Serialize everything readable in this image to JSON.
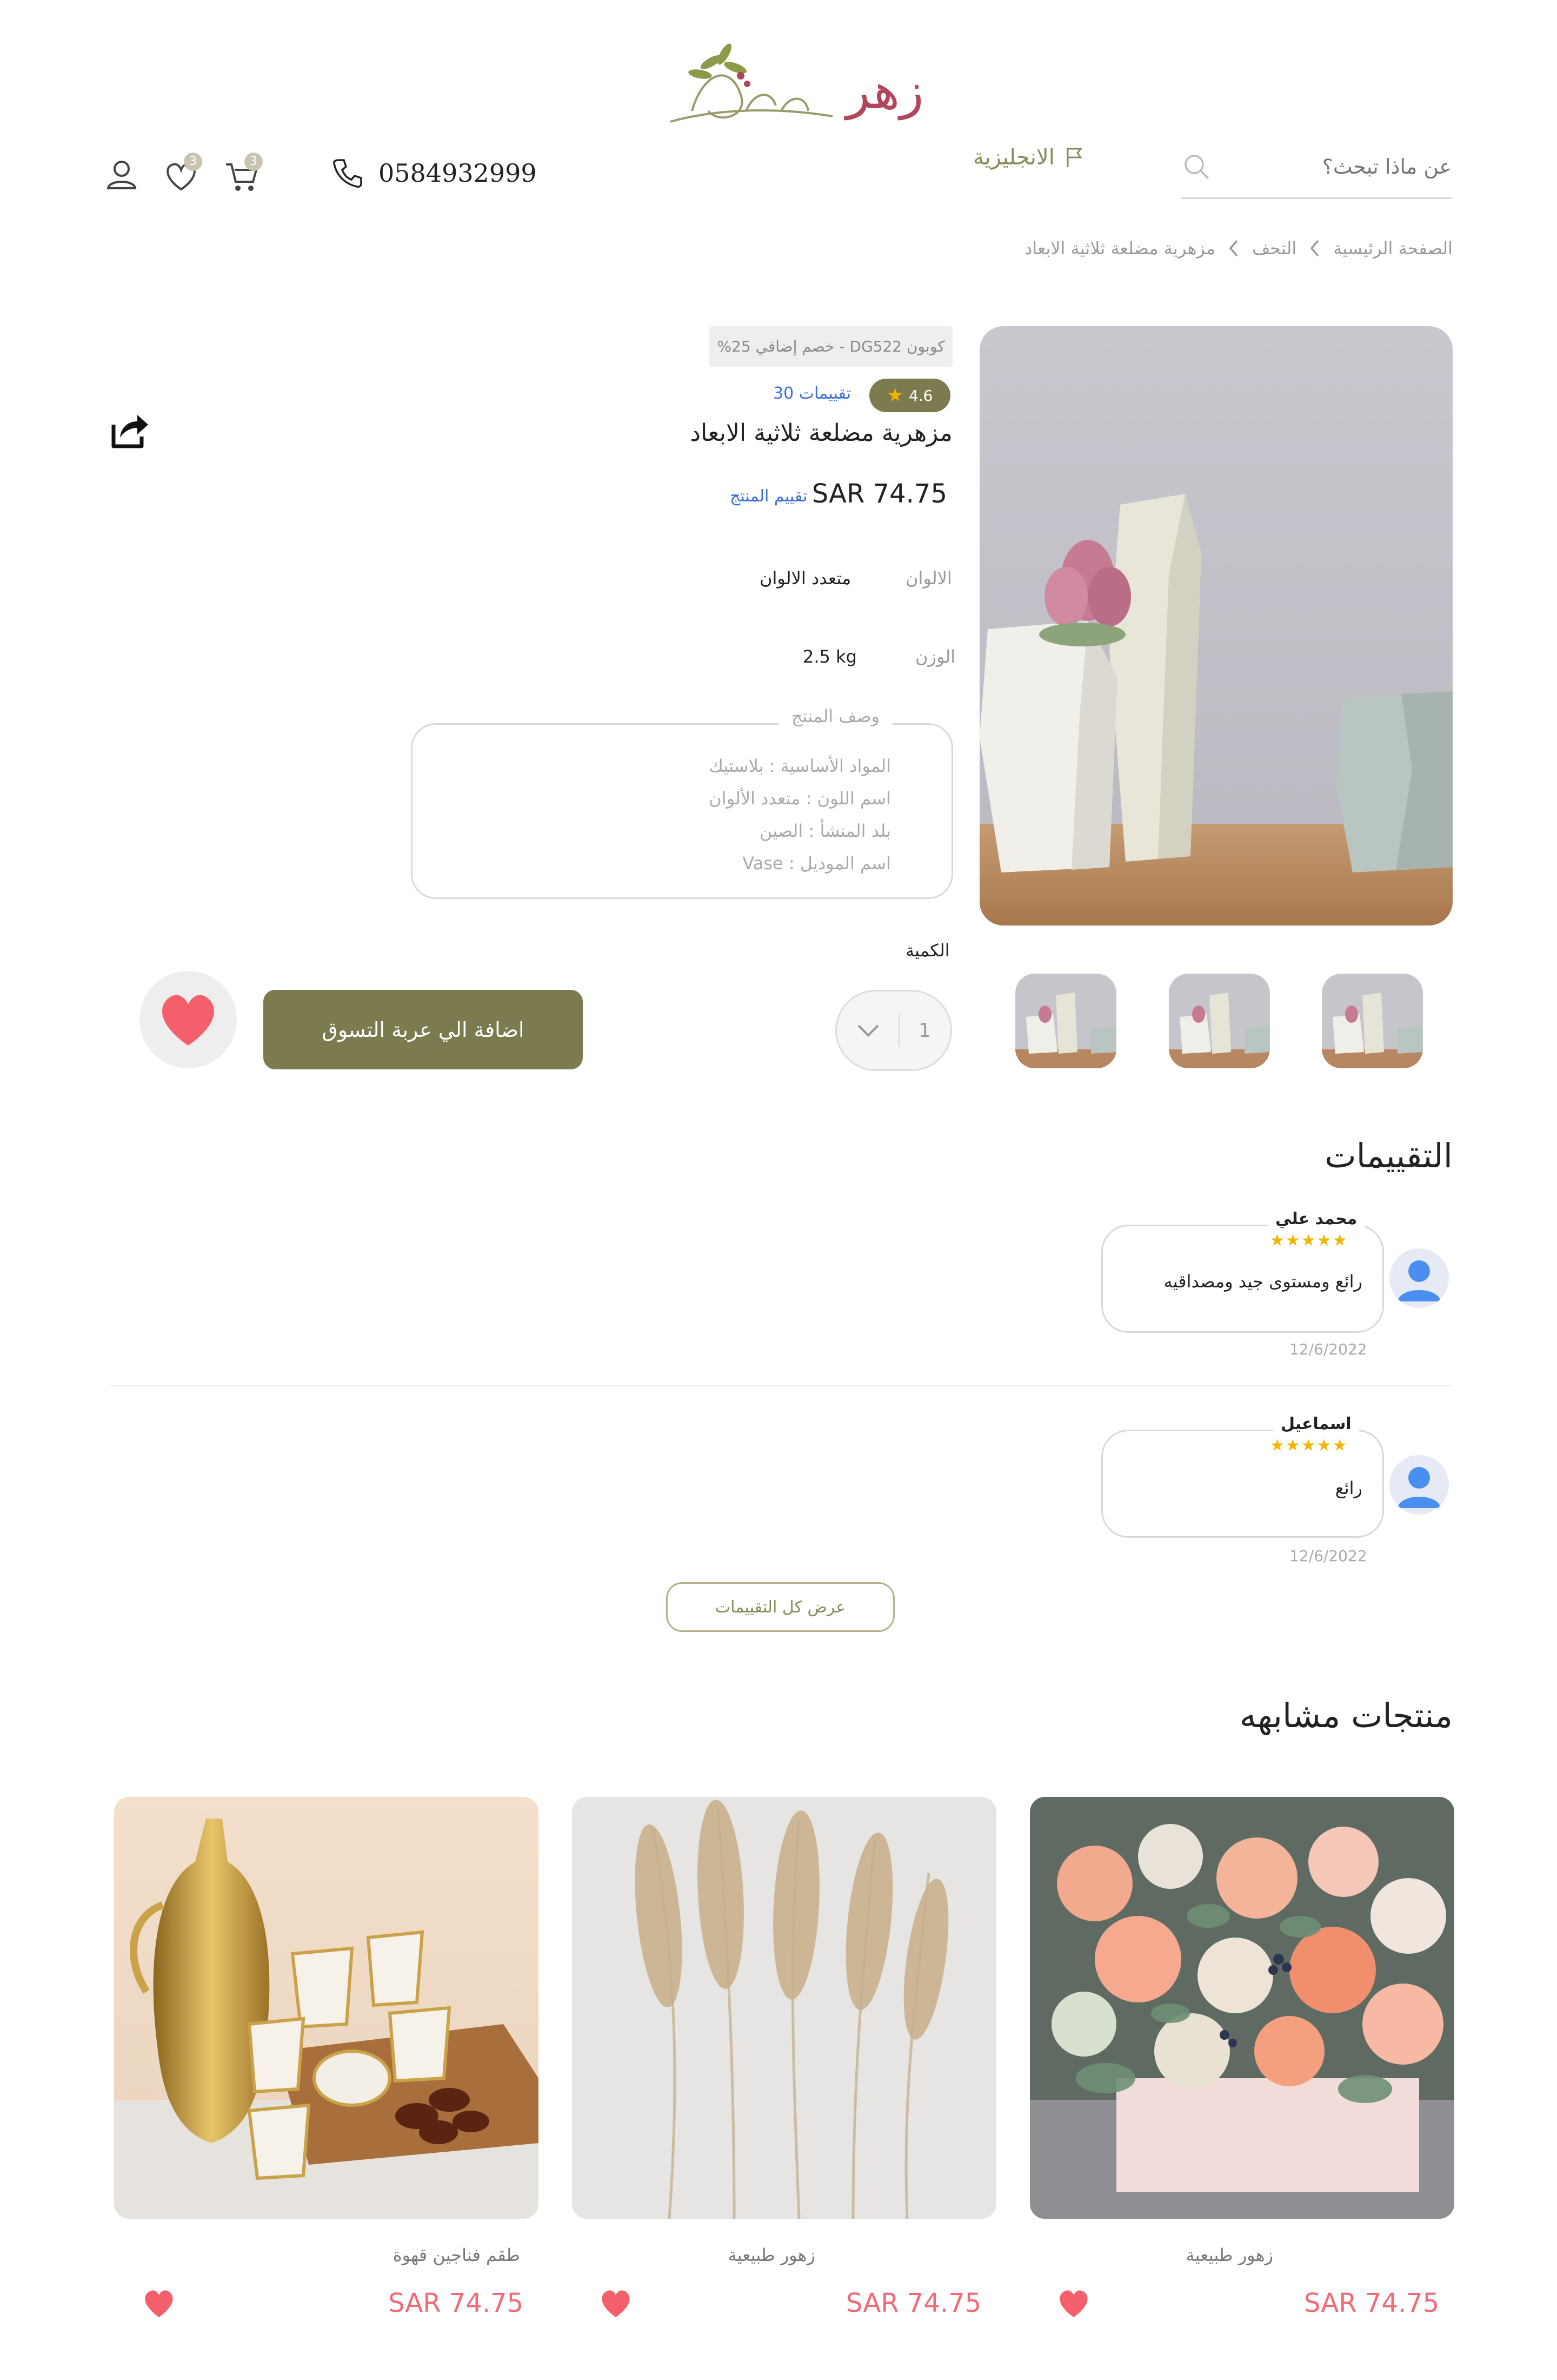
{
  "colors": {
    "accent": "#7b7b4f",
    "price_red": "#f06a78",
    "brand": "#b0465c",
    "link_blue": "#3a6fd8"
  },
  "header": {
    "logo_text_ar": "زهر",
    "phone": "0584932999",
    "cart_count": "3",
    "wishlist_count": "3",
    "language_label": "الانجليزية",
    "search_placeholder": "عن ماذا تبحث؟"
  },
  "breadcrumb": {
    "home": "الصفحة الرئيسية",
    "category": "التحف",
    "current": "مزهرية مضلعة ثلاثية الابعاد"
  },
  "product": {
    "coupon": "كوبون DG522 - خصم إضافي 25%",
    "rating": "4.6",
    "reviews_count": "30 تقييمات",
    "title": "مزهرية مضلعة ثلاثية الابعاد",
    "price": "SAR 74.75",
    "rate_link": "تقييم المنتج",
    "colors_label": "الالوان",
    "colors_value": "متعدد الالوان",
    "weight_label": "الوزن",
    "weight_value": "2.5 kg",
    "description_title": "وصف المنتج",
    "description_lines": [
      "المواد الأساسية : بلاستيك",
      "اسم اللون : متعدد الألوان",
      "بلد المنشأ : الصين",
      "اسم الموديل : Vase"
    ],
    "quantity_label": "الكمية",
    "quantity_value": "1",
    "add_to_cart": "اضافة الي عربة التسوق"
  },
  "reviews": {
    "title": "التقييمات",
    "items": [
      {
        "name": "محمد علي",
        "stars": "★★★★★",
        "text": "رائع ومستوى جيد ومصداقيه",
        "date": "12/6/2022"
      },
      {
        "name": "اسماعيل",
        "stars": "★★★★★",
        "text": "رائع",
        "date": "12/6/2022"
      }
    ],
    "view_all": "عرض كل التقييمات"
  },
  "similar": {
    "title": "منتجات مشابهه",
    "items": [
      {
        "name": "زهور طبيعية",
        "price": "SAR 74.75"
      },
      {
        "name": "زهور طبيعية",
        "price": "SAR 74.75"
      },
      {
        "name": "طقم فناجين قهوة",
        "price": "SAR 74.75"
      }
    ]
  }
}
